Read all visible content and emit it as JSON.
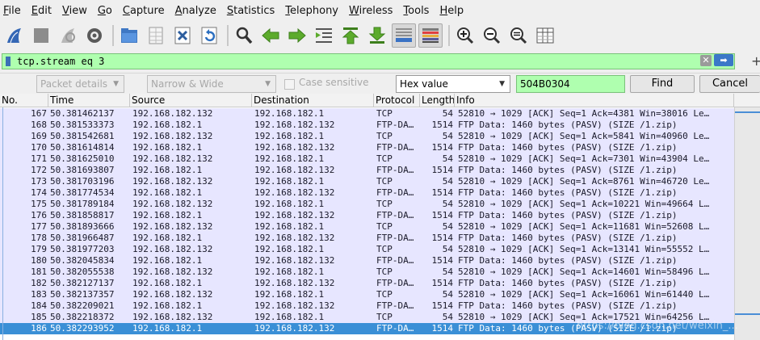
{
  "menu": [
    "File",
    "Edit",
    "View",
    "Go",
    "Capture",
    "Analyze",
    "Statistics",
    "Telephony",
    "Wireless",
    "Tools",
    "Help"
  ],
  "toolbar_icons": [
    "shark-fin-start-icon",
    "stop-capture-icon",
    "restart-capture-icon",
    "capture-options-icon",
    "open-file-icon",
    "file-set-icon",
    "close-file-icon",
    "reload-icon",
    "find-packet-icon",
    "go-back-icon",
    "go-forward-icon",
    "go-to-packet-icon",
    "go-first-icon",
    "go-last-icon",
    "auto-scroll-icon",
    "colorize-icon",
    "zoom-in-icon",
    "zoom-out-icon",
    "normal-size-icon",
    "resize-columns-icon"
  ],
  "display_filter": {
    "value": "tcp.stream eq 3"
  },
  "find": {
    "search_in": "Packet details",
    "char_width": "Narrow & Wide",
    "case_sensitive_label": "Case sensitive",
    "search_type": "Hex value",
    "search_value": "504B0304",
    "find_label": "Find",
    "cancel_label": "Cancel"
  },
  "columns": [
    "No.",
    "Time",
    "Source",
    "Destination",
    "Protocol",
    "Length",
    "Info"
  ],
  "packets": [
    {
      "no": "167",
      "time": "50.381462137",
      "src": "192.168.182.132",
      "dst": "192.168.182.1",
      "proto": "TCP",
      "len": "54",
      "info": "52810 → 1029 [ACK] Seq=1 Ack=4381 Win=38016 Le…"
    },
    {
      "no": "168",
      "time": "50.381533373",
      "src": "192.168.182.1",
      "dst": "192.168.182.132",
      "proto": "FTP-DA…",
      "len": "1514",
      "info": "FTP Data: 1460 bytes (PASV) (SIZE /1.zip)"
    },
    {
      "no": "169",
      "time": "50.381542681",
      "src": "192.168.182.132",
      "dst": "192.168.182.1",
      "proto": "TCP",
      "len": "54",
      "info": "52810 → 1029 [ACK] Seq=1 Ack=5841 Win=40960 Le…"
    },
    {
      "no": "170",
      "time": "50.381614814",
      "src": "192.168.182.1",
      "dst": "192.168.182.132",
      "proto": "FTP-DA…",
      "len": "1514",
      "info": "FTP Data: 1460 bytes (PASV) (SIZE /1.zip)"
    },
    {
      "no": "171",
      "time": "50.381625010",
      "src": "192.168.182.132",
      "dst": "192.168.182.1",
      "proto": "TCP",
      "len": "54",
      "info": "52810 → 1029 [ACK] Seq=1 Ack=7301 Win=43904 Le…"
    },
    {
      "no": "172",
      "time": "50.381693807",
      "src": "192.168.182.1",
      "dst": "192.168.182.132",
      "proto": "FTP-DA…",
      "len": "1514",
      "info": "FTP Data: 1460 bytes (PASV) (SIZE /1.zip)"
    },
    {
      "no": "173",
      "time": "50.381703196",
      "src": "192.168.182.132",
      "dst": "192.168.182.1",
      "proto": "TCP",
      "len": "54",
      "info": "52810 → 1029 [ACK] Seq=1 Ack=8761 Win=46720 Le…"
    },
    {
      "no": "174",
      "time": "50.381774534",
      "src": "192.168.182.1",
      "dst": "192.168.182.132",
      "proto": "FTP-DA…",
      "len": "1514",
      "info": "FTP Data: 1460 bytes (PASV) (SIZE /1.zip)"
    },
    {
      "no": "175",
      "time": "50.381789184",
      "src": "192.168.182.132",
      "dst": "192.168.182.1",
      "proto": "TCP",
      "len": "54",
      "info": "52810 → 1029 [ACK] Seq=1 Ack=10221 Win=49664 L…"
    },
    {
      "no": "176",
      "time": "50.381858817",
      "src": "192.168.182.1",
      "dst": "192.168.182.132",
      "proto": "FTP-DA…",
      "len": "1514",
      "info": "FTP Data: 1460 bytes (PASV) (SIZE /1.zip)"
    },
    {
      "no": "177",
      "time": "50.381893666",
      "src": "192.168.182.132",
      "dst": "192.168.182.1",
      "proto": "TCP",
      "len": "54",
      "info": "52810 → 1029 [ACK] Seq=1 Ack=11681 Win=52608 L…"
    },
    {
      "no": "178",
      "time": "50.381966487",
      "src": "192.168.182.1",
      "dst": "192.168.182.132",
      "proto": "FTP-DA…",
      "len": "1514",
      "info": "FTP Data: 1460 bytes (PASV) (SIZE /1.zip)"
    },
    {
      "no": "179",
      "time": "50.381977203",
      "src": "192.168.182.132",
      "dst": "192.168.182.1",
      "proto": "TCP",
      "len": "54",
      "info": "52810 → 1029 [ACK] Seq=1 Ack=13141 Win=55552 L…"
    },
    {
      "no": "180",
      "time": "50.382045834",
      "src": "192.168.182.1",
      "dst": "192.168.182.132",
      "proto": "FTP-DA…",
      "len": "1514",
      "info": "FTP Data: 1460 bytes (PASV) (SIZE /1.zip)"
    },
    {
      "no": "181",
      "time": "50.382055538",
      "src": "192.168.182.132",
      "dst": "192.168.182.1",
      "proto": "TCP",
      "len": "54",
      "info": "52810 → 1029 [ACK] Seq=1 Ack=14601 Win=58496 L…"
    },
    {
      "no": "182",
      "time": "50.382127137",
      "src": "192.168.182.1",
      "dst": "192.168.182.132",
      "proto": "FTP-DA…",
      "len": "1514",
      "info": "FTP Data: 1460 bytes (PASV) (SIZE /1.zip)"
    },
    {
      "no": "183",
      "time": "50.382137357",
      "src": "192.168.182.132",
      "dst": "192.168.182.1",
      "proto": "TCP",
      "len": "54",
      "info": "52810 → 1029 [ACK] Seq=1 Ack=16061 Win=61440 L…"
    },
    {
      "no": "184",
      "time": "50.382209021",
      "src": "192.168.182.1",
      "dst": "192.168.182.132",
      "proto": "FTP-DA…",
      "len": "1514",
      "info": "FTP Data: 1460 bytes (PASV) (SIZE /1.zip)"
    },
    {
      "no": "185",
      "time": "50.382218372",
      "src": "192.168.182.132",
      "dst": "192.168.182.1",
      "proto": "TCP",
      "len": "54",
      "info": "52810 → 1029 [ACK] Seq=1 Ack=17521 Win=64256 L…"
    },
    {
      "no": "186",
      "time": "50.382293952",
      "src": "192.168.182.1",
      "dst": "192.168.182.132",
      "proto": "FTP-DA…",
      "len": "1514",
      "info": "FTP Data: 1460 bytes (PASV) (SIZE /1.zip)",
      "selected": true
    }
  ],
  "watermark": "https://blog.csdn.net/weixin_...",
  "colors": {
    "filter_valid": "#afffaf",
    "row_bg": "#e7e6ff",
    "row_selected": "#3a8fd6"
  }
}
